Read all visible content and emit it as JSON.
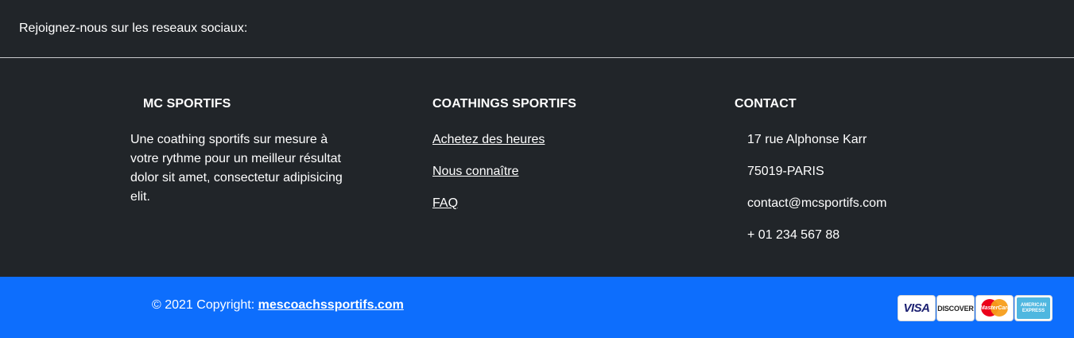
{
  "social": {
    "label": "Rejoignez-nous sur les reseaux sociaux:"
  },
  "columns": {
    "brand": {
      "title": "MC SPORTIFS",
      "description": "Une coathing sportifs sur mesure à votre rythme pour un meilleur résultat dolor sit amet, consectetur adipisicing elit."
    },
    "coaching": {
      "title": "COATHINGS SPORTIFS",
      "links": [
        "Achetez des heures",
        "Nous connaître",
        "FAQ"
      ]
    },
    "contact": {
      "title": "CONTACT",
      "address": "17 rue Alphonse Karr",
      "city": "75019-PARIS",
      "email": "contact@mcsportifs.com",
      "phone": "+ 01 234 567 88"
    }
  },
  "bottom": {
    "copyright_prefix": "© 2021 Copyright: ",
    "copyright_link": "mescoachssportifs.com",
    "payment_cards": {
      "visa": "VISA",
      "discover": "DISCOVER",
      "mastercard": "MasterCard",
      "amex": "AMERICAN EXPRESS"
    }
  },
  "colors": {
    "dark_bg": "#212529",
    "accent": "#0d6efd",
    "text": "#ffffff"
  }
}
